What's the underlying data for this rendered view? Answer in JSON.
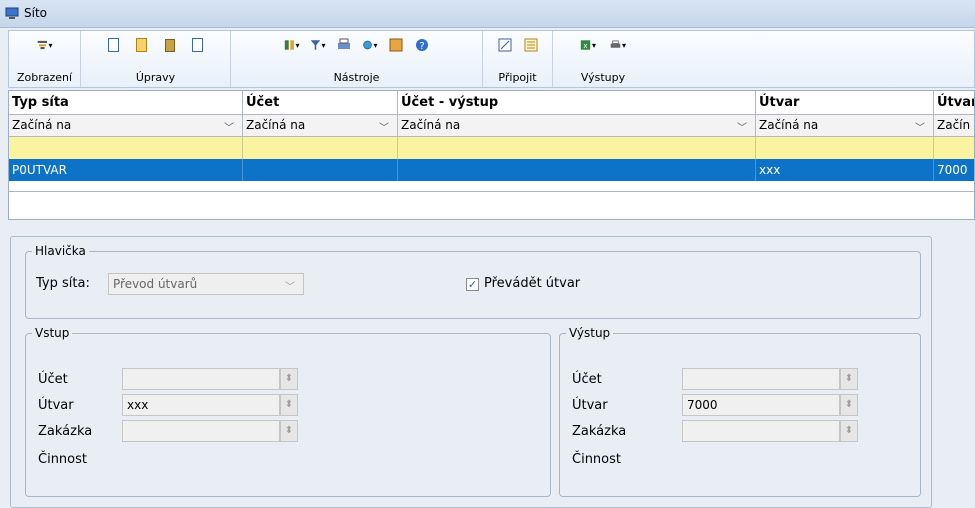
{
  "window": {
    "title": "Síto"
  },
  "toolbar": {
    "groups": [
      {
        "label": "Zobrazení"
      },
      {
        "label": "Úpravy"
      },
      {
        "label": "Nástroje"
      },
      {
        "label": "Připojit"
      },
      {
        "label": "Výstupy"
      }
    ]
  },
  "grid": {
    "columns": [
      "Typ síta",
      "Účet",
      "Účet - výstup",
      "Útvar",
      "Útvar"
    ],
    "filters": [
      "Začíná na",
      "Začíná na",
      "Začíná na",
      "Začíná na",
      "Začín"
    ],
    "rows": [
      {
        "typ_sita": "P0UTVAR",
        "ucet": "",
        "ucet_vystup": "",
        "utvar": "xxx",
        "utvar_vystup": "7000"
      }
    ]
  },
  "detail": {
    "hlavicka": {
      "legend": "Hlavička",
      "typ_sita_label": "Typ síta:",
      "typ_sita_value": "Převod útvarů",
      "prevadet_label": "Převádět útvar",
      "prevadet_checked": true
    },
    "vstup": {
      "legend": "Vstup",
      "ucet_label": "Účet",
      "ucet_value": "",
      "utvar_label": "Útvar",
      "utvar_value": "xxx",
      "zakazka_label": "Zakázka",
      "zakazka_value": "",
      "cinnost_label": "Činnost"
    },
    "vystup": {
      "legend": "Výstup",
      "ucet_label": "Účet",
      "ucet_value": "",
      "utvar_label": "Útvar",
      "utvar_value": "7000",
      "zakazka_label": "Zakázka",
      "zakazka_value": "",
      "cinnost_label": "Činnost"
    }
  },
  "colors": {
    "selection": "#0c73c8",
    "new_row": "#fbf3a0"
  }
}
